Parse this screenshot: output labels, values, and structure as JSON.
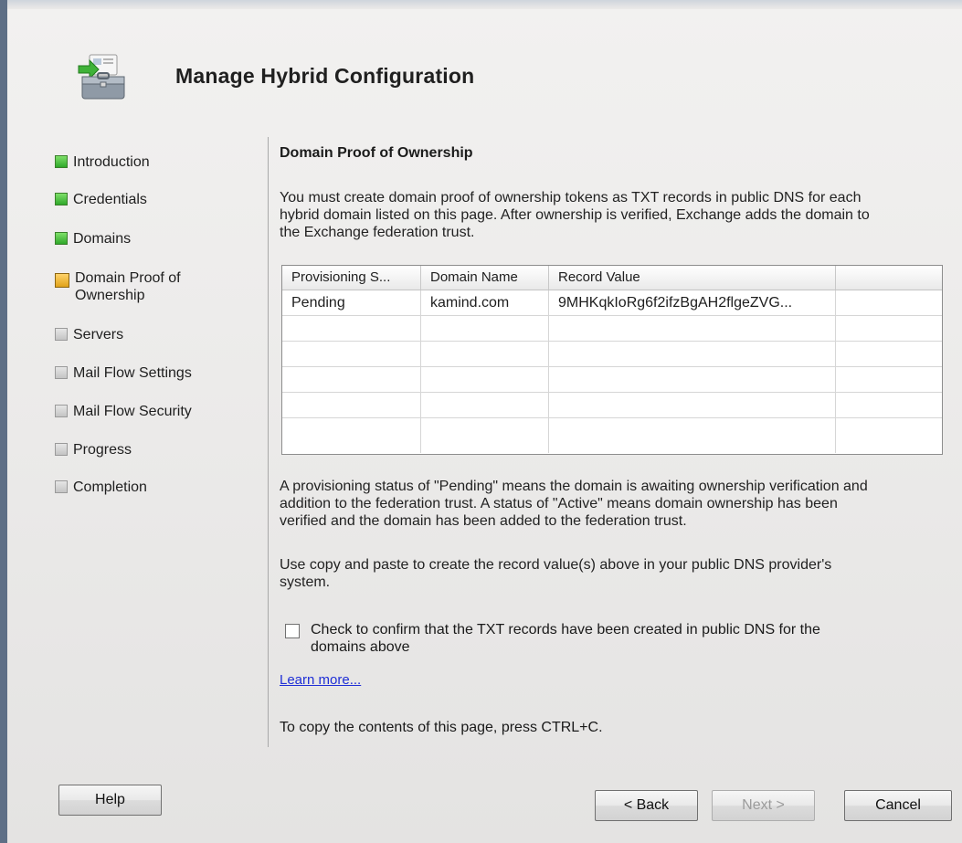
{
  "header": {
    "title": "Manage Hybrid Configuration",
    "icon": "hybrid-config-toolbox-icon"
  },
  "sidebar": {
    "steps": [
      {
        "label": "Introduction",
        "status": "complete"
      },
      {
        "label": "Credentials",
        "status": "complete"
      },
      {
        "label": "Domains",
        "status": "complete"
      },
      {
        "label": "Domain Proof of Ownership",
        "status": "current"
      },
      {
        "label": "Servers",
        "status": "pending"
      },
      {
        "label": "Mail Flow Settings",
        "status": "pending"
      },
      {
        "label": "Mail Flow Security",
        "status": "pending"
      },
      {
        "label": "Progress",
        "status": "pending"
      },
      {
        "label": "Completion",
        "status": "pending"
      }
    ]
  },
  "main": {
    "section_title": "Domain Proof of Ownership",
    "intro_line1": "You must create domain proof of ownership tokens as TXT records in public DNS for each",
    "intro_line2": "hybrid domain listed on this page. After ownership is verified, Exchange adds the domain to",
    "intro_line3": "the Exchange federation trust.",
    "grid": {
      "columns": [
        "Provisioning S...",
        "Domain Name",
        "Record Value",
        ""
      ],
      "rows": [
        [
          "Pending",
          "kamind.com",
          "9MHKqkIoRg6f2ifzBgAH2flgeZVG...",
          ""
        ]
      ]
    },
    "status_line1": "A provisioning status of \"Pending\" means the domain is awaiting ownership verification and",
    "status_line2": "addition to the federation trust. A status of \"Active\" means domain ownership has been",
    "status_line3": "verified and the domain has been added to the federation trust.",
    "copy_line1": "Use copy and paste to create the record value(s) above in your public DNS provider's",
    "copy_line2": "system.",
    "confirm_checkbox": {
      "checked": false,
      "label_line1": "Check to confirm that the TXT records have been created in public DNS for the",
      "label_line2": "domains above"
    },
    "learn_more": "Learn more...",
    "copy_hint": "To copy the contents of this page, press CTRL+C."
  },
  "footer": {
    "help": "Help",
    "back": "< Back",
    "next": "Next >",
    "cancel": "Cancel"
  }
}
